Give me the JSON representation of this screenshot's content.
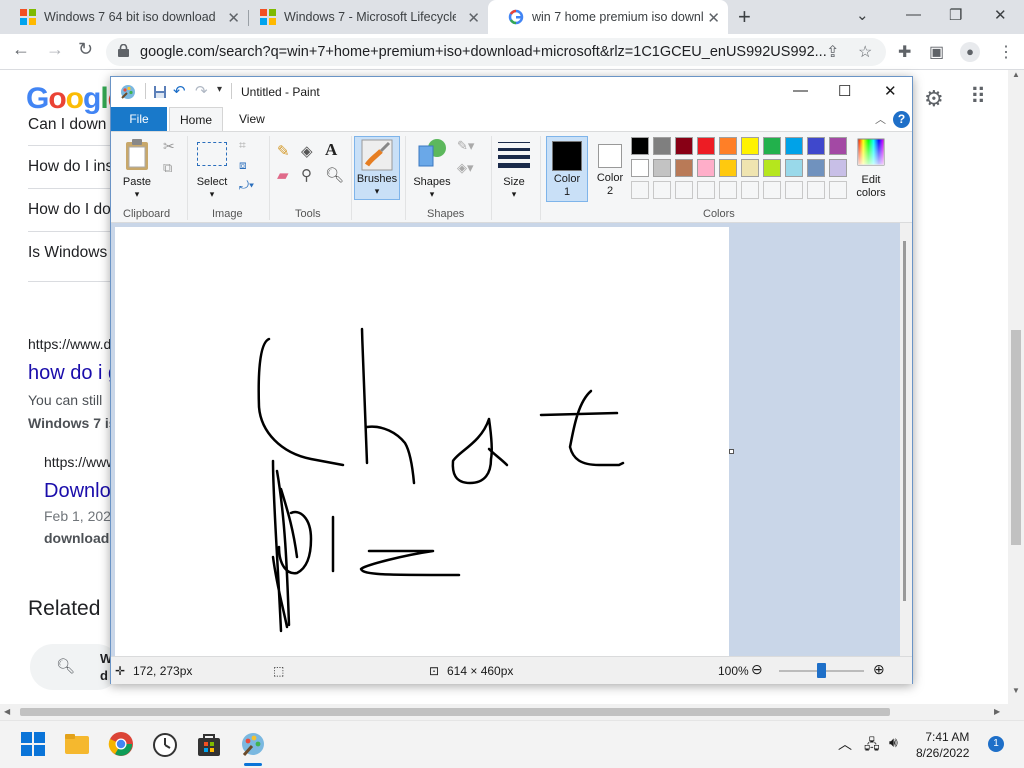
{
  "browser": {
    "tabs": [
      {
        "title": "Windows 7 64 bit iso download",
        "icon": "windows-logo-icon"
      },
      {
        "title": "Windows 7 - Microsoft Lifecycle",
        "icon": "windows-logo-icon"
      },
      {
        "title": "win 7 home premium iso downlo",
        "icon": "google-g-icon",
        "active": true
      }
    ],
    "url": "google.com/search?q=win+7+home+premium+iso+download+microsoft&rlz=1C1GCEU_enUS992US992..."
  },
  "google": {
    "logo": "Google",
    "questions": [
      "Can I down",
      "How do I ins",
      "How do I do",
      "Is Windows"
    ],
    "result1": {
      "url": "https://www.d",
      "title": "how do i g",
      "snippet1": "You can still",
      "snippet2": "Windows 7 is"
    },
    "result2": {
      "url": "https://www",
      "title": "Downlo",
      "date": "Feb 1, 202",
      "snippet": "download"
    },
    "related": "Related",
    "related_item": "W\nd"
  },
  "paint": {
    "title": "Untitled - Paint",
    "tabs": {
      "file": "File",
      "home": "Home",
      "view": "View"
    },
    "ribbon": {
      "paste": "Paste",
      "select": "Select",
      "brushes": "Brushes",
      "shapes": "Shapes",
      "size": "Size",
      "color1": "Color\n1",
      "color2": "Color\n2",
      "edit_colors": "Edit\ncolors",
      "groups": [
        "Clipboard",
        "Image",
        "Tools",
        "Shapes",
        "Colors"
      ]
    },
    "palette_row1": [
      "#000000",
      "#7f7f7f",
      "#880015",
      "#ed1c24",
      "#ff7f27",
      "#fff200",
      "#22b14c",
      "#00a2e8",
      "#3f48cc",
      "#a349a4"
    ],
    "palette_row2": [
      "#ffffff",
      "#c3c3c3",
      "#b97a57",
      "#ffaec9",
      "#ffc90e",
      "#efe4b0",
      "#b5e61d",
      "#99d9ea",
      "#7092be",
      "#c8bfe7"
    ],
    "color1": "#000000",
    "color2": "#ffffff",
    "status": {
      "cursor_pos": "172, 273px",
      "image_size": "614 × 460px",
      "zoom": "100%"
    }
  },
  "taskbar": {
    "time": "7:41 AM",
    "date": "8/26/2022",
    "notifications": "1"
  }
}
